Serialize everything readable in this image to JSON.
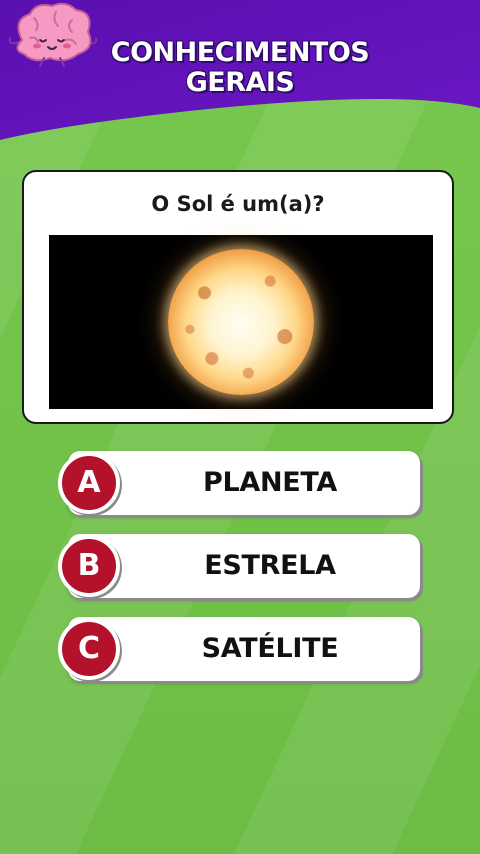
{
  "header": {
    "title_line1": "CONHECIMENTOS",
    "title_line2": "GERAIS",
    "colors": {
      "purple": "#6412b8",
      "purple_dark": "#4b0a94"
    }
  },
  "question": {
    "text": "O Sol é um(a)?",
    "image_icon": "sun-photo"
  },
  "options": [
    {
      "letter": "A",
      "label": "PLANETA"
    },
    {
      "letter": "B",
      "label": "ESTRELA"
    },
    {
      "letter": "C",
      "label": "SATÉLITE"
    }
  ],
  "colors": {
    "background": "#6fbf4a",
    "badge": "#b3122a",
    "card": "#ffffff"
  }
}
